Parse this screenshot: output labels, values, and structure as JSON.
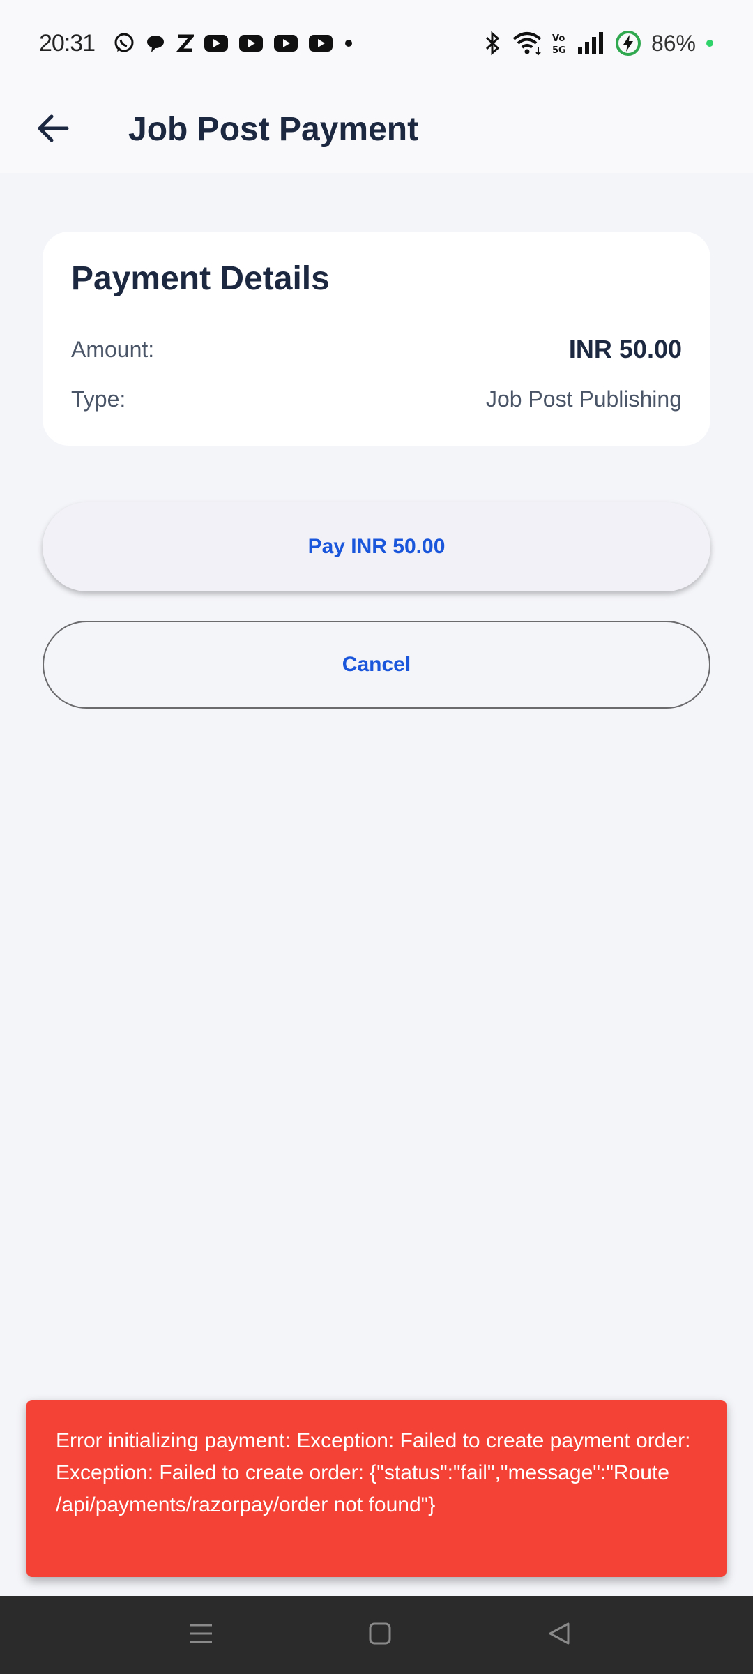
{
  "status_bar": {
    "time": "20:31",
    "battery": "86%",
    "notification_icons": [
      "whatsapp-icon",
      "chat-bubble-icon",
      "z-icon",
      "youtube-icon",
      "youtube-icon",
      "youtube-icon",
      "youtube-icon",
      "dot-icon"
    ],
    "system_icons": [
      "bluetooth-icon",
      "wifi-icon",
      "volte-5g-icon",
      "signal-icon",
      "battery-charging-icon"
    ]
  },
  "app_bar": {
    "back_icon": "arrow-left-icon",
    "title": "Job Post Payment"
  },
  "payment_card": {
    "title": "Payment Details",
    "amount_label": "Amount:",
    "amount_value": "INR 50.00",
    "type_label": "Type:",
    "type_value": "Job Post Publishing"
  },
  "actions": {
    "pay_label": "Pay INR 50.00",
    "cancel_label": "Cancel"
  },
  "snackbar": {
    "message": "Error initializing payment: Exception: Failed to create payment order: Exception: Failed to create order: {\"status\":\"fail\",\"message\":\"Route /api/payments/razorpay/order not found\"}"
  },
  "colors": {
    "accent": "#1a56db",
    "title": "#1c2740",
    "error": "#f44336",
    "background": "#f4f5f9",
    "charging": "#2fa84f"
  }
}
